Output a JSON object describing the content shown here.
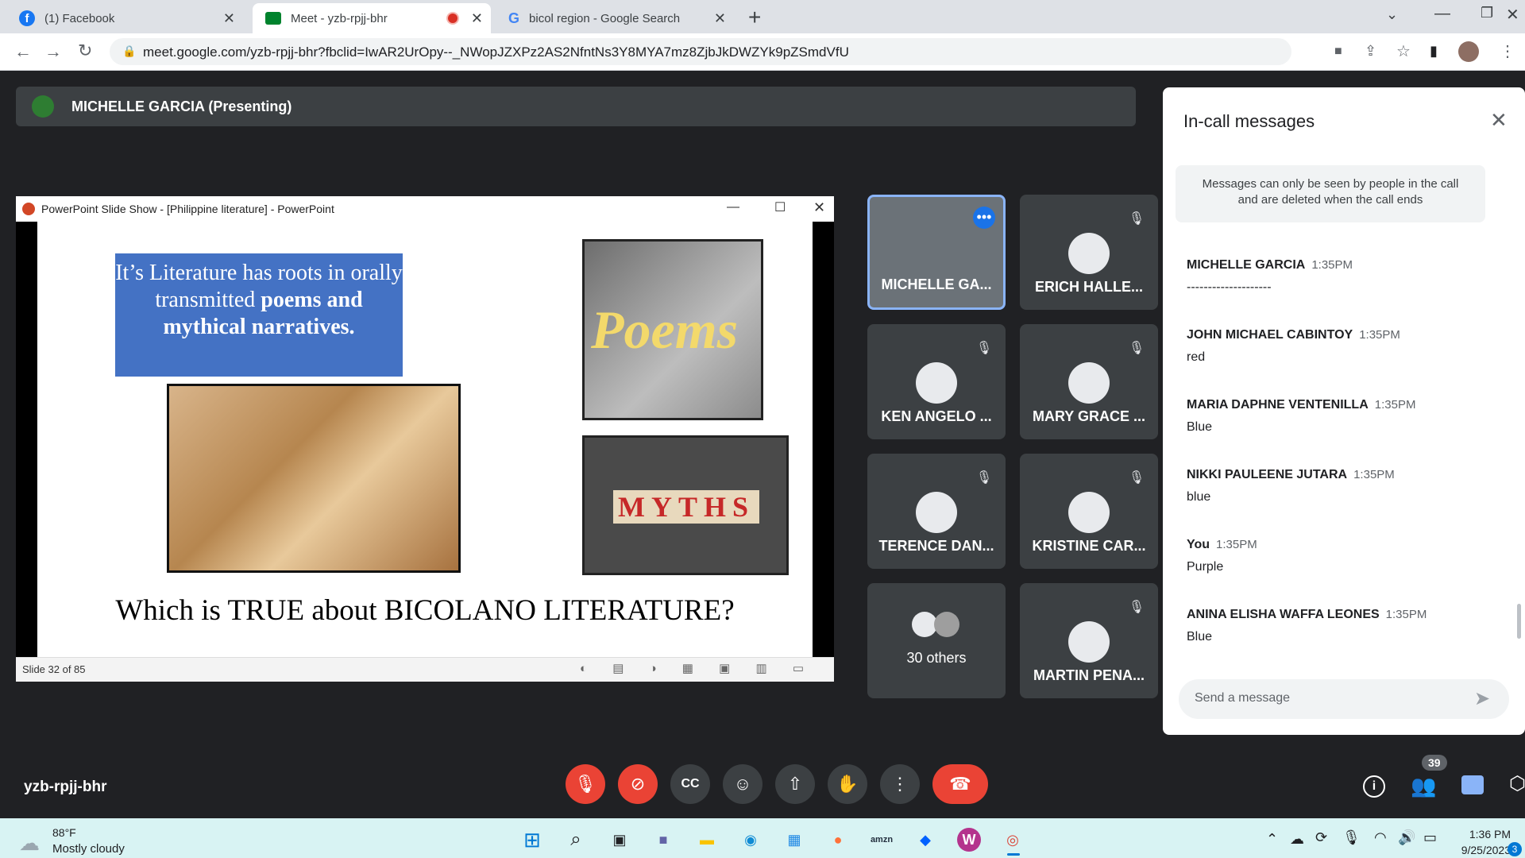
{
  "browser": {
    "tabs": [
      {
        "label": "(1) Facebook"
      },
      {
        "label": "Meet - yzb-rpjj-bhr"
      },
      {
        "label": "bicol region - Google Search"
      }
    ],
    "url": "meet.google.com/yzb-rpjj-bhr?fbclid=IwAR2UrOpy--_NWopJZXPz2AS2NfntNs3Y8MYA7mz8ZjbJkDWZYk9pZSmdVfU"
  },
  "meet": {
    "presenter_label": "MICHELLE GARCIA (Presenting)",
    "meeting_code": "yzb-rpjj-bhr",
    "participants_count": "39",
    "tiles": [
      {
        "name": "MICHELLE GA..."
      },
      {
        "name": "ERICH HALLE..."
      },
      {
        "name": "KEN ANGELO ..."
      },
      {
        "name": "MARY GRACE ..."
      },
      {
        "name": "TERENCE DAN..."
      },
      {
        "name": "KRISTINE CAR..."
      },
      {
        "name": "30 others"
      },
      {
        "name": "MARTIN PENA..."
      }
    ]
  },
  "ppt": {
    "window_title": "PowerPoint Slide Show - [Philippine literature] - PowerPoint",
    "slide_box_text_1": "It’s Literature has  roots in orally transmitted ",
    "slide_box_bold": "poems and mythical narratives.",
    "poems_label": "Poems",
    "myths_label": "MYTHS",
    "question": "Which is TRUE about BICOLANO LITERATURE?",
    "status": "Slide 32 of 85"
  },
  "chat": {
    "title": "In-call messages",
    "notice": "Messages can only be seen by people in the call and are deleted when the call ends",
    "messages": [
      {
        "author": "MICHELLE GARCIA",
        "time": "1:35PM",
        "text": "--------------------"
      },
      {
        "author": "JOHN MICHAEL CABINTOY",
        "time": "1:35PM",
        "text": "red"
      },
      {
        "author": "MARIA DAPHNE VENTENILLA",
        "time": "1:35PM",
        "text": "Blue"
      },
      {
        "author": "NIKKI PAULEENE JUTARA",
        "time": "1:35PM",
        "text": "blue"
      },
      {
        "author": "You",
        "time": "1:35PM",
        "text": "Purple"
      },
      {
        "author": "ANINA ELISHA WAFFA LEONES",
        "time": "1:35PM",
        "text": "Blue"
      }
    ],
    "input_placeholder": "Send a message"
  },
  "taskbar": {
    "weather_temp": "88°F",
    "weather_desc": "Mostly cloudy",
    "time": "1:36 PM",
    "date": "9/25/2023",
    "notification_count": "3"
  },
  "colors": {
    "meet_bg": "#202124",
    "tile_bg": "#3c4043",
    "danger": "#ea4335",
    "accent": "#8ab4f8",
    "slide_box": "#4472c4"
  },
  "icons": [
    "back-icon",
    "forward-icon",
    "reload-icon",
    "lock-icon",
    "camera-icon",
    "share-icon",
    "star-icon",
    "sidebar-icon",
    "menu-icon",
    "mic-off-icon",
    "cam-off-icon",
    "cc-icon",
    "emoji-icon",
    "present-icon",
    "hand-icon",
    "more-icon",
    "hangup-icon",
    "info-icon",
    "people-icon",
    "chat-icon",
    "activities-icon",
    "send-icon",
    "close-icon"
  ]
}
